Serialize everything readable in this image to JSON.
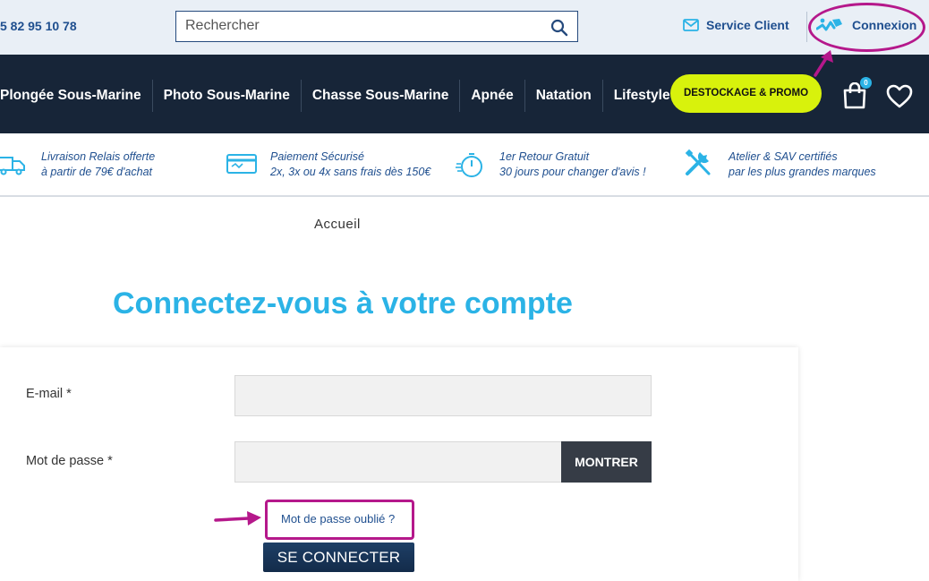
{
  "topbar": {
    "phone": "5 82 95 10 78",
    "search_placeholder": "Rechercher",
    "service_label": "Service Client",
    "login_label": "Connexion"
  },
  "nav": {
    "items": [
      "Plongée Sous-Marine",
      "Photo Sous-Marine",
      "Chasse Sous-Marine",
      "Apnée",
      "Natation",
      "Lifestyle"
    ],
    "promo_label": "DESTOCKAGE & PROMO",
    "cart_count": "0"
  },
  "reassurance": [
    {
      "line1": "Livraison Relais offerte",
      "line2": "à partir de 79€ d'achat",
      "icon": "truck-icon"
    },
    {
      "line1": "Paiement Sécurisé",
      "line2": "2x, 3x ou 4x sans frais dès 150€",
      "icon": "credit-card-icon"
    },
    {
      "line1": "1er Retour Gratuit",
      "line2": "30 jours pour changer d'avis !",
      "icon": "stopwatch-icon"
    },
    {
      "line1": "Atelier & SAV certifiés",
      "line2": "par les plus grandes marques",
      "icon": "tools-icon"
    }
  ],
  "breadcrumb": "Accueil",
  "page_title": "Connectez-vous à votre compte",
  "form": {
    "email_label": "E-mail *",
    "email_value": "",
    "password_label": "Mot de passe *",
    "password_value": "",
    "show_label": "MONTRER",
    "forgot_label": "Mot de passe oublié ?",
    "submit_label": "SE CONNECTER"
  },
  "colors": {
    "accent": "#2bb3e6",
    "nav_bg": "#172538",
    "promo": "#d8f20c",
    "annotation": "#b5188b"
  }
}
